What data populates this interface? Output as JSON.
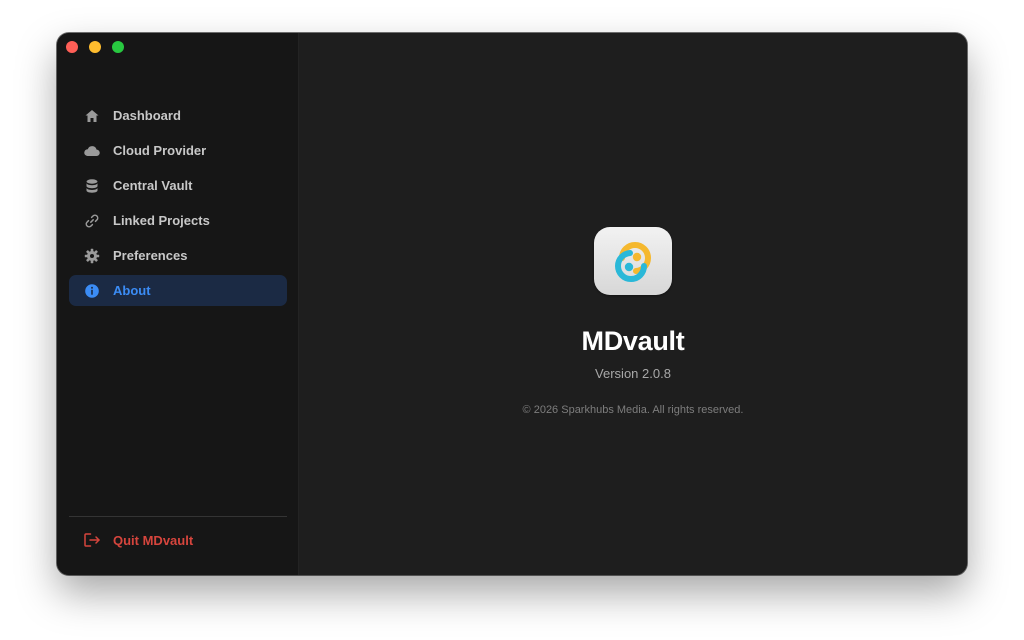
{
  "window": {
    "controls": [
      {
        "name": "close",
        "color": "#ff5f57"
      },
      {
        "name": "minimize",
        "color": "#febc2e"
      },
      {
        "name": "zoom",
        "color": "#28c840"
      }
    ]
  },
  "sidebar": {
    "items": [
      {
        "label": "Dashboard",
        "icon": "home-icon",
        "active": false
      },
      {
        "label": "Cloud Provider",
        "icon": "cloud-icon",
        "active": false
      },
      {
        "label": "Central Vault",
        "icon": "database-icon",
        "active": false
      },
      {
        "label": "Linked Projects",
        "icon": "link-icon",
        "active": false
      },
      {
        "label": "Preferences",
        "icon": "gear-icon",
        "active": false
      },
      {
        "label": "About",
        "icon": "info-icon",
        "active": true
      }
    ],
    "quit_label": "Quit MDvault",
    "quit_icon": "logout-icon"
  },
  "about": {
    "app_icon": "mdvault-logo-icon",
    "app_name": "MDvault",
    "version": "Version 2.0.8",
    "copyright": "© 2026 Sparkhubs Media. All rights reserved."
  },
  "colors": {
    "accent": "#3b8cf5",
    "active_bg": "#1b2a44",
    "danger": "#d6453d",
    "logo_yellow": "#f5b82e",
    "logo_cyan": "#2ab8d8"
  }
}
